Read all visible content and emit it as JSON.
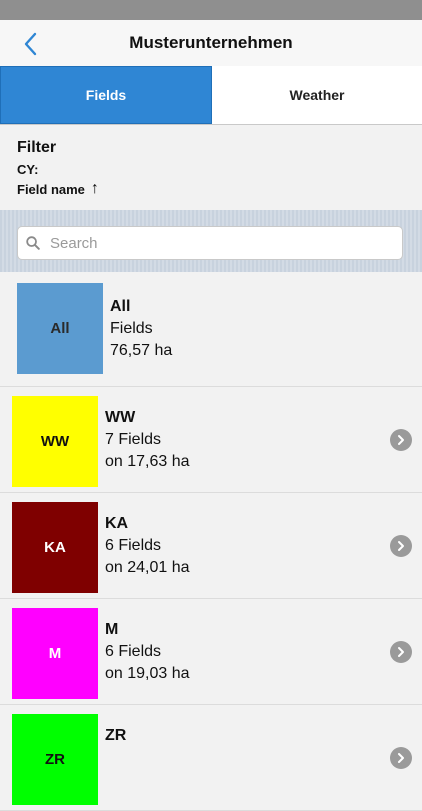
{
  "navbar": {
    "title": "Musterunternehmen",
    "back_icon": "chevron-left-icon"
  },
  "segments": [
    {
      "label": "Fields",
      "active": true
    },
    {
      "label": "Weather",
      "active": false
    }
  ],
  "filter": {
    "heading": "Filter",
    "cy_label": "CY:",
    "field_name_label": "Field name",
    "sort_arrow": "↑"
  },
  "search": {
    "placeholder": "Search",
    "value": ""
  },
  "colors": {
    "accent": "#2f86d4"
  },
  "list": [
    {
      "code": "All",
      "line2": "Fields",
      "line3": "76,57 ha",
      "color": "#5b9bd0",
      "text_color": "#2a2a2a"
    },
    {
      "code": "WW",
      "line2": "7 Fields",
      "line3": "on 17,63 ha",
      "color": "#ffff00",
      "text_color": "#111111"
    },
    {
      "code": "KA",
      "line2": "6 Fields",
      "line3": "on 24,01 ha",
      "color": "#7f0000",
      "text_color": "#ffffff"
    },
    {
      "code": "M",
      "line2": "6 Fields",
      "line3": "on 19,03 ha",
      "color": "#ff00ff",
      "text_color": "#ffffff"
    },
    {
      "code": "ZR",
      "line2": "",
      "line3": "",
      "color": "#00ff00",
      "text_color": "#111111"
    }
  ]
}
